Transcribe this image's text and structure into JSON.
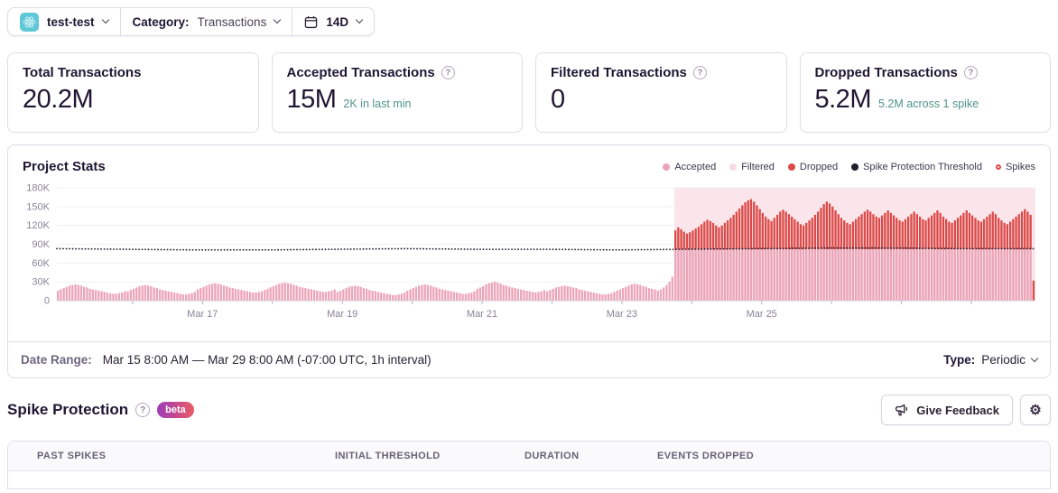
{
  "icons": {
    "help": "?",
    "gear": "⚙"
  },
  "header": {
    "project_name": "test-test",
    "category_label": "Category:",
    "category_value": "Transactions",
    "range_button_label": "14D"
  },
  "stat_cards": [
    {
      "title": "Total Transactions",
      "value": "20.2M",
      "subtitle": "",
      "has_help": false
    },
    {
      "title": "Accepted Transactions",
      "value": "15M",
      "subtitle": "2K in last min",
      "has_help": true
    },
    {
      "title": "Filtered Transactions",
      "value": "0",
      "subtitle": "",
      "has_help": true
    },
    {
      "title": "Dropped Transactions",
      "value": "5.2M",
      "subtitle": "5.2M across 1 spike",
      "has_help": true
    }
  ],
  "chart": {
    "legend": [
      {
        "label": "Accepted",
        "color": "#eba4b8",
        "shape": "dot"
      },
      {
        "label": "Filtered",
        "color": "#f7dbe3",
        "shape": "dot"
      },
      {
        "label": "Dropped",
        "color": "#dc4a48",
        "shape": "dot"
      },
      {
        "label": "Spike Protection Threshold",
        "color": "#241a2e",
        "shape": "dot"
      },
      {
        "label": "Spikes",
        "color": "#dc4a48",
        "shape": "ring"
      }
    ]
  },
  "chart_data": {
    "type": "bar",
    "stacked": true,
    "title": "Project Stats",
    "x_start": "Mar 15 8:00 AM",
    "x_end": "Mar 29 8:00 AM",
    "interval": "1h",
    "buckets": 336,
    "unit": "K",
    "ylim_k": [
      0,
      180
    ],
    "y_ticks_k": [
      180,
      150,
      120,
      90,
      60,
      30,
      0
    ],
    "x_ticks": [
      {
        "bucket": 26,
        "label": ""
      },
      {
        "bucket": 50,
        "label": "Mar 17"
      },
      {
        "bucket": 74,
        "label": ""
      },
      {
        "bucket": 98,
        "label": "Mar 19"
      },
      {
        "bucket": 122,
        "label": ""
      },
      {
        "bucket": 146,
        "label": "Mar 21"
      },
      {
        "bucket": 170,
        "label": ""
      },
      {
        "bucket": 194,
        "label": "Mar 23"
      },
      {
        "bucket": 218,
        "label": ""
      },
      {
        "bucket": 242,
        "label": "Mar 25"
      },
      {
        "bucket": 266,
        "label": ""
      },
      {
        "bucket": 290,
        "label": ""
      },
      {
        "bucket": 314,
        "label": ""
      }
    ],
    "threshold_k": [
      83,
      82,
      81,
      81,
      82,
      83,
      82,
      82,
      81,
      82,
      83,
      84,
      84,
      83,
      83
    ],
    "threshold_color": "#241a2e",
    "spike_region": {
      "start_bucket": 212,
      "end_bucket": 336,
      "color": "#fae6ea"
    },
    "series": [
      {
        "name": "Accepted",
        "color": "#eba4b8",
        "start_bucket": 0,
        "values_k": [
          16,
          18,
          20,
          22,
          24,
          25,
          26,
          25,
          24,
          22,
          21,
          19,
          18,
          17,
          16,
          15,
          14,
          13,
          12,
          11,
          11,
          12,
          13,
          15,
          15,
          17,
          19,
          21,
          23,
          24,
          25,
          24,
          23,
          21,
          20,
          18,
          17,
          16,
          15,
          14,
          13,
          12,
          11,
          10,
          10,
          11,
          12,
          14,
          18,
          20,
          22,
          24,
          26,
          27,
          28,
          27,
          26,
          24,
          23,
          21,
          20,
          19,
          18,
          17,
          16,
          15,
          14,
          13,
          13,
          14,
          15,
          17,
          19,
          21,
          23,
          25,
          27,
          28,
          29,
          28,
          27,
          25,
          24,
          22,
          21,
          20,
          19,
          18,
          17,
          16,
          15,
          14,
          14,
          15,
          16,
          18,
          14,
          16,
          18,
          20,
          22,
          23,
          24,
          23,
          22,
          20,
          19,
          17,
          16,
          15,
          14,
          13,
          12,
          11,
          10,
          9,
          9,
          10,
          11,
          13,
          16,
          18,
          20,
          22,
          24,
          25,
          26,
          25,
          24,
          22,
          21,
          19,
          18,
          17,
          16,
          15,
          14,
          13,
          12,
          11,
          11,
          12,
          13,
          15,
          19,
          21,
          23,
          26,
          28,
          29,
          30,
          29,
          27,
          25,
          24,
          22,
          21,
          20,
          19,
          18,
          17,
          16,
          15,
          14,
          13,
          14,
          15,
          17,
          15,
          17,
          19,
          21,
          22,
          23,
          24,
          23,
          22,
          21,
          20,
          18,
          17,
          16,
          15,
          14,
          13,
          12,
          11,
          10,
          10,
          11,
          12,
          14,
          16,
          18,
          20,
          22,
          24,
          26,
          27,
          26,
          25,
          23,
          22,
          20,
          19,
          18,
          16,
          18,
          21,
          25,
          30,
          38,
          82,
          82,
          82,
          82,
          82,
          82,
          82,
          82,
          82,
          82,
          82,
          82,
          82,
          82,
          82,
          82,
          82,
          82,
          82,
          82,
          82,
          82,
          82,
          82,
          82,
          82,
          82,
          82,
          82,
          82,
          82,
          82,
          82,
          82,
          82,
          82,
          82,
          82,
          82,
          82,
          82,
          82,
          82,
          82,
          82,
          82,
          82,
          82,
          82,
          82,
          82,
          82,
          82,
          82,
          82,
          82,
          82,
          82,
          82,
          82,
          82,
          82,
          82,
          82,
          82,
          82,
          82,
          82,
          82,
          82,
          82,
          82,
          82,
          82,
          82,
          82,
          82,
          82,
          82,
          82,
          82,
          82,
          82,
          82,
          82,
          82,
          82,
          82,
          82,
          82,
          82,
          82,
          82,
          82,
          82,
          82,
          82,
          82,
          82,
          82,
          82,
          82,
          82,
          82,
          82,
          82,
          82,
          82,
          82,
          82,
          82,
          82,
          82,
          82,
          82,
          82,
          82,
          82,
          82,
          82,
          82,
          82,
          82,
          0
        ]
      },
      {
        "name": "Dropped",
        "color": "#dc4a48",
        "start_bucket": 212,
        "values_k": [
          30,
          35,
          32,
          28,
          25,
          27,
          30,
          33,
          36,
          40,
          44,
          47,
          45,
          42,
          38,
          35,
          38,
          42,
          46,
          50,
          55,
          60,
          65,
          70,
          75,
          78,
          80,
          76,
          70,
          64,
          58,
          52,
          48,
          45,
          50,
          55,
          60,
          63,
          60,
          56,
          52,
          48,
          44,
          40,
          38,
          42,
          46,
          50,
          55,
          60,
          66,
          72,
          76,
          73,
          68,
          62,
          56,
          50,
          46,
          42,
          40,
          44,
          48,
          52,
          56,
          60,
          63,
          60,
          56,
          52,
          50,
          54,
          58,
          62,
          58,
          54,
          50,
          46,
          44,
          48,
          52,
          56,
          60,
          56,
          52,
          48,
          46,
          50,
          54,
          58,
          62,
          58,
          52,
          48,
          44,
          42,
          46,
          50,
          54,
          58,
          62,
          58,
          54,
          50,
          46,
          44,
          48,
          52,
          56,
          60,
          56,
          50,
          46,
          42,
          40,
          44,
          48,
          52,
          56,
          60,
          64,
          60,
          55,
          32
        ]
      },
      {
        "name": "Filtered",
        "color": "#f7dbe3",
        "start_bucket": 0,
        "values_k": []
      }
    ]
  },
  "footer": {
    "date_range_label": "Date Range:",
    "date_range_value": "Mar 15 8:00 AM — Mar 29 8:00 AM (-07:00 UTC, 1h interval)",
    "type_label": "Type:",
    "type_value": "Periodic"
  },
  "spike_protection": {
    "title": "Spike Protection",
    "beta_badge": "beta",
    "feedback_button_label": "Give Feedback"
  },
  "table": {
    "columns": [
      "PAST SPIKES",
      "INITIAL THRESHOLD",
      "DURATION",
      "EVENTS DROPPED"
    ]
  }
}
